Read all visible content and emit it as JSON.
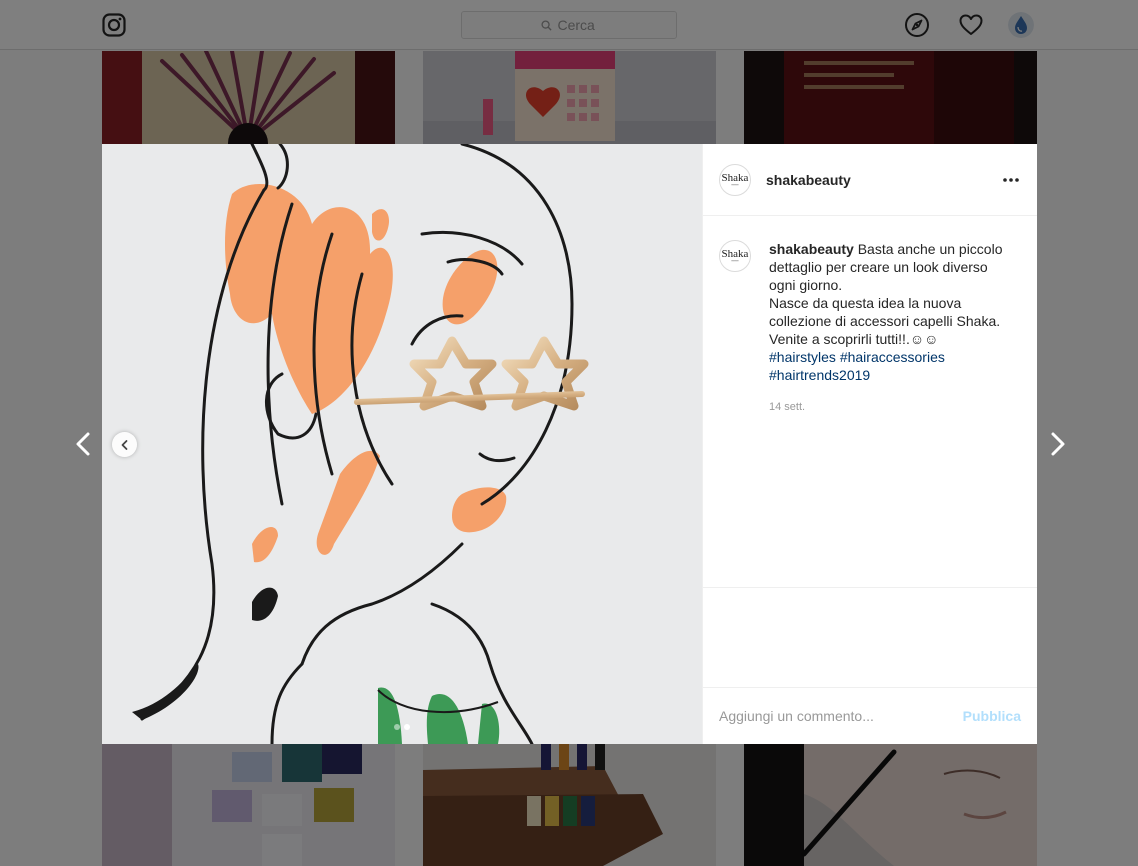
{
  "nav": {
    "logo_icon": "instagram-icon",
    "search_placeholder": "Cerca",
    "search_icon": "search-icon",
    "explore_icon": "compass-icon",
    "activity_icon": "heart-icon",
    "profile_icon": "avatar"
  },
  "post": {
    "username": "shakabeauty",
    "avatar_wordmark": "Shaka",
    "more_icon": "more-horizontal-icon",
    "caption_username": "shakabeauty",
    "caption_line1": " Basta anche un piccolo dettaglio per creare un look diverso ogni giorno.",
    "caption_line2": "Nasce da questa idea la nuova collezione di accessori capelli Shaka.",
    "caption_line3": "Venite a scoprirli tutti!!.☺☺",
    "hashtags": [
      "#hairstyles",
      "#hairaccessories",
      "#hairtrends2019"
    ],
    "timestamp": "14 sett.",
    "carousel": {
      "current": 2,
      "total": 2
    }
  },
  "comment": {
    "placeholder": "Aggiungi un commento...",
    "publish_label": "Pubblica"
  },
  "colors": {
    "accent_orange": "#f5a06a",
    "hashtag_blue": "#003569",
    "publish_disabled": "#b2dffc"
  }
}
